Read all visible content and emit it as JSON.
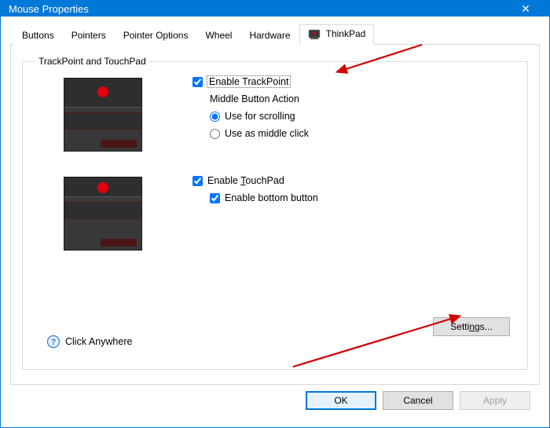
{
  "window": {
    "title": "Mouse Properties"
  },
  "tabs": {
    "items": [
      {
        "label": "Buttons"
      },
      {
        "label": "Pointers"
      },
      {
        "label": "Pointer Options"
      },
      {
        "label": "Wheel"
      },
      {
        "label": "Hardware"
      },
      {
        "label": "ThinkPad"
      }
    ],
    "active": 5
  },
  "groupbox": {
    "title": "TrackPoint and TouchPad"
  },
  "trackpoint": {
    "enable_label": "Enable TrackPoint",
    "enable_checked": true,
    "middle_action_label": "Middle Button Action",
    "radio_scroll_label": "Use for scrolling",
    "radio_click_label": "Use as middle click",
    "radio_selected": "scroll"
  },
  "touchpad": {
    "enable_label_prefix": "Enable ",
    "enable_label_u": "T",
    "enable_label_suffix": "ouchPad",
    "enable_checked": true,
    "bottom_label": "Enable bottom button",
    "bottom_checked": true
  },
  "click_anywhere": {
    "label": "Click Anywhere"
  },
  "settings": {
    "label_prefix": "Setti",
    "label_u": "n",
    "label_suffix": "gs..."
  },
  "buttons": {
    "ok": "OK",
    "cancel": "Cancel",
    "apply": "Apply"
  }
}
